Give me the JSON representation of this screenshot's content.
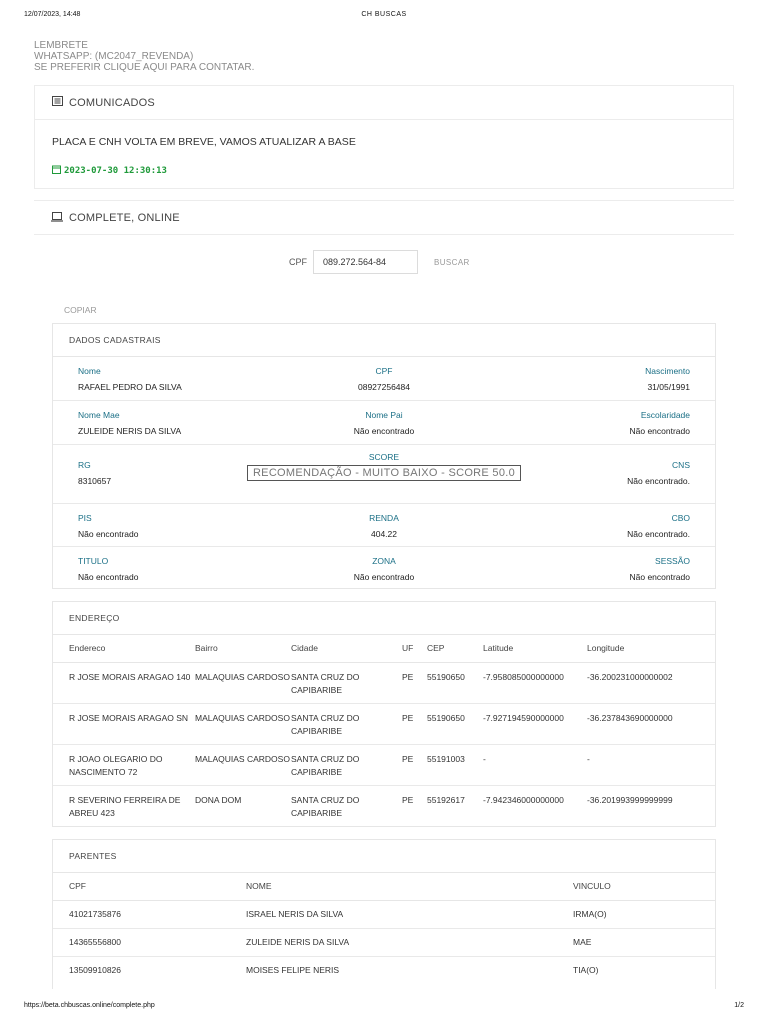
{
  "print": {
    "datetime": "12/07/2023, 14:48",
    "title": "CH BUSCAS",
    "url": "https://beta.chbuscas.online/complete.php",
    "page": "1/2"
  },
  "reminder": {
    "line1": "LEMBRETE",
    "line2": "WHATSAPP: (MC2047_REVENDA)",
    "line3": "SE PREFERIR CLIQUE AQUI PARA CONTATAR."
  },
  "comunicados": {
    "title": "COMUNICADOS",
    "message": "PLACA E CNH VOLTA EM BREVE, VAMOS ATUALIZAR A BASE",
    "date": "2023-07-30 12:30:13"
  },
  "online": {
    "title": "COMPLETE, ONLINE"
  },
  "search": {
    "label": "CPF",
    "value": "089.272.564-84",
    "button": "BUSCAR"
  },
  "copiar": "COPIAR",
  "dados": {
    "title": "DADOS CADASTRAIS",
    "nome_k": "Nome",
    "nome_v": "RAFAEL PEDRO DA SILVA",
    "cpf_k": "CPF",
    "cpf_v": "08927256484",
    "nasc_k": "Nascimento",
    "nasc_v": "31/05/1991",
    "mae_k": "Nome Mae",
    "mae_v": "ZULEIDE NERIS DA SILVA",
    "pai_k": "Nome Pai",
    "pai_v": "Não encontrado",
    "esc_k": "Escolaridade",
    "esc_v": "Não encontrado",
    "rg_k": "RG",
    "rg_v": "8310657",
    "score_k": "SCORE",
    "score_v": "RECOMENDAÇÃO - MUITO BAIXO - SCORE 50.0",
    "cns_k": "CNS",
    "cns_v": "Não encontrado.",
    "pis_k": "PIS",
    "pis_v": "Não encontrado",
    "renda_k": "RENDA",
    "renda_v": "404.22",
    "cbo_k": "CBO",
    "cbo_v": "Não encontrado.",
    "titulo_k": "TITULO",
    "titulo_v": "Não encontrado",
    "zona_k": "ZONA",
    "zona_v": "Não encontrado",
    "sessao_k": "SESSÃO",
    "sessao_v": "Não encontrado"
  },
  "endereco": {
    "title": "ENDEREÇO",
    "headers": [
      "Endereco",
      "Bairro",
      "Cidade",
      "UF",
      "CEP",
      "Latitude",
      "Longitude"
    ],
    "rows": [
      [
        "R JOSE MORAIS ARAGAO 140",
        "MALAQUIAS CARDOSO",
        "SANTA CRUZ DO CAPIBARIBE",
        "PE",
        "55190650",
        "-7.958085000000000",
        "-36.200231000000002"
      ],
      [
        "R JOSE MORAIS ARAGAO SN",
        "MALAQUIAS CARDOSO",
        "SANTA CRUZ DO CAPIBARIBE",
        "PE",
        "55190650",
        "-7.927194590000000",
        "-36.237843690000000"
      ],
      [
        "R JOAO OLEGARIO DO NASCIMENTO 72",
        "MALAQUIAS CARDOSO",
        "SANTA CRUZ DO CAPIBARIBE",
        "PE",
        "55191003",
        "-",
        "-"
      ],
      [
        "R SEVERINO FERREIRA DE ABREU 423",
        "DONA DOM",
        "SANTA CRUZ DO CAPIBARIBE",
        "PE",
        "55192617",
        "-7.942346000000000",
        "-36.201993999999999"
      ]
    ]
  },
  "parentes": {
    "title": "PARENTES",
    "headers": [
      "CPF",
      "NOME",
      "VINCULO"
    ],
    "rows": [
      [
        "41021735876",
        "ISRAEL NERIS DA SILVA",
        "IRMA(O)"
      ],
      [
        "14365556800",
        "ZULEIDE NERIS DA SILVA",
        "MAE"
      ],
      [
        "13509910826",
        "MOISES FELIPE NERIS",
        "TIA(O)"
      ]
    ]
  }
}
